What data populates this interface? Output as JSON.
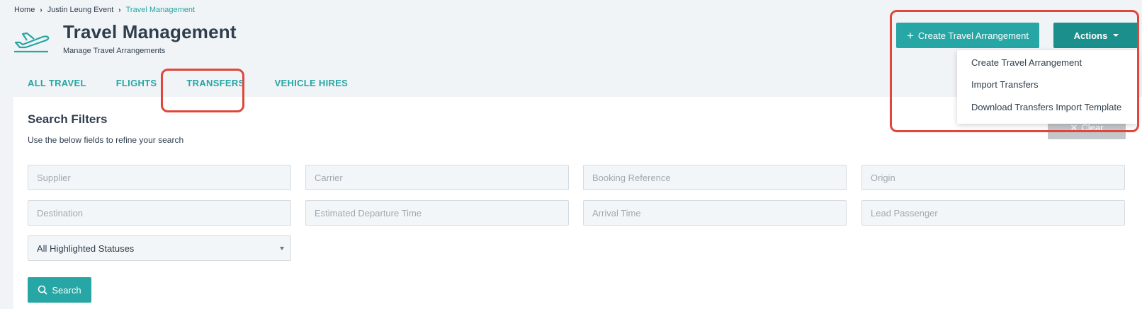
{
  "breadcrumb": {
    "home": "Home",
    "event": "Justin Leung Event",
    "current": "Travel Management"
  },
  "header": {
    "title": "Travel Management",
    "subtitle": "Manage Travel Arrangements",
    "icon": "airplane-icon"
  },
  "toolbar": {
    "create_label": "Create Travel Arrangement",
    "actions_label": "Actions"
  },
  "actions_menu": {
    "items": [
      {
        "label": "Create Travel Arrangement"
      },
      {
        "label": "Import Transfers"
      },
      {
        "label": "Download Transfers Import Template"
      }
    ]
  },
  "tabs": [
    {
      "label": "ALL TRAVEL"
    },
    {
      "label": "FLIGHTS"
    },
    {
      "label": "TRANSFERS",
      "active": true
    },
    {
      "label": "VEHICLE HIRES"
    }
  ],
  "filters": {
    "title": "Search Filters",
    "subtitle": "Use the below fields to refine your search",
    "clear_label": "Clear",
    "fields": [
      {
        "placeholder": "Supplier"
      },
      {
        "placeholder": "Carrier"
      },
      {
        "placeholder": "Booking Reference"
      },
      {
        "placeholder": "Origin"
      },
      {
        "placeholder": "Destination"
      },
      {
        "placeholder": "Estimated Departure Time"
      },
      {
        "placeholder": "Arrival Time"
      },
      {
        "placeholder": "Lead Passenger"
      }
    ],
    "status_select": "All Highlighted Statuses",
    "search_label": "Search"
  },
  "colors": {
    "accent": "#26a6a4",
    "accent_dark": "#1a8f8b",
    "highlight": "#e0473a",
    "text": "#2f3e4d"
  }
}
